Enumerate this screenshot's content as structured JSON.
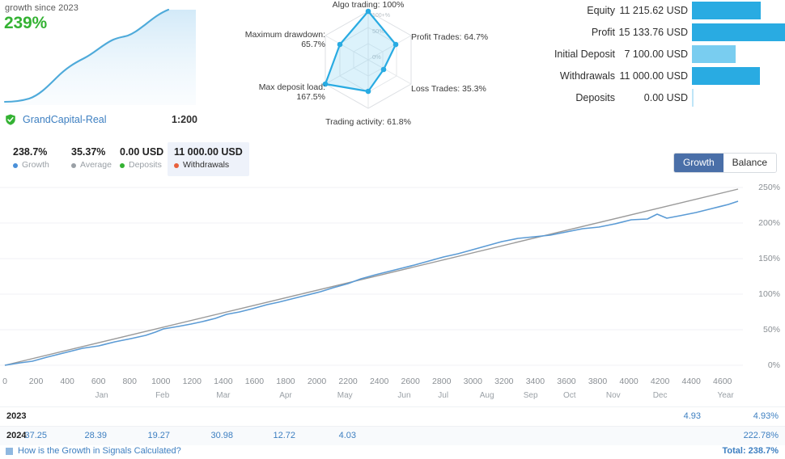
{
  "summary": {
    "growth_since_label": "growth since 2023",
    "growth_since_value": "239%",
    "broker": "GrandCapital-Real",
    "leverage": "1:200",
    "verified_icon": "shield-check-icon"
  },
  "radar": {
    "title": "",
    "ring_labels": [
      "100+%",
      "50%",
      "0%"
    ],
    "axes": [
      {
        "label": "Algo trading: 100%",
        "name": "Algo trading",
        "value": 100.0,
        "norm": 1.0
      },
      {
        "label": "Profit Trades: 64.7%",
        "name": "Profit Trades",
        "value": 64.7,
        "norm": 0.647
      },
      {
        "label": "Loss Trades: 35.3%",
        "name": "Loss Trades",
        "value": 35.3,
        "norm": 0.353
      },
      {
        "label": "Trading activity: 61.8%",
        "name": "Trading activity",
        "value": 61.8,
        "norm": 0.618
      },
      {
        "label": "Max deposit load: 167.5%",
        "name": "Max deposit load",
        "value": 167.5,
        "norm": 1.0
      },
      {
        "label": "Maximum drawdown: 65.7%",
        "name": "Maximum drawdown",
        "value": 65.7,
        "norm": 0.657
      }
    ]
  },
  "account_bars": {
    "rows": [
      {
        "name": "Equity",
        "value": "11 215.62 USD",
        "amount": 11215.62,
        "bar_pct": 74,
        "tone": "normal"
      },
      {
        "name": "Profit",
        "value": "15 133.76 USD",
        "amount": 15133.76,
        "bar_pct": 100,
        "tone": "normal"
      },
      {
        "name": "Initial Deposit",
        "value": "7 100.00 USD",
        "amount": 7100.0,
        "bar_pct": 47,
        "tone": "light"
      },
      {
        "name": "Withdrawals",
        "value": "11 000.00 USD",
        "amount": 11000.0,
        "bar_pct": 73,
        "tone": "normal"
      },
      {
        "name": "Deposits",
        "value": "0.00 USD",
        "amount": 0.0,
        "bar_pct": 0,
        "tone": "zero"
      }
    ]
  },
  "stats": [
    {
      "value": "238.7%",
      "key": "Growth",
      "color": "#4a90d9",
      "highlighted": false
    },
    {
      "value": "35.37%",
      "key": "Average",
      "color": "#9aa0a6",
      "highlighted": false
    },
    {
      "value": "0.00 USD",
      "key": "Deposits",
      "color": "#34b233",
      "highlighted": false
    },
    {
      "value": "11 000.00 USD",
      "key": "Withdrawals",
      "color": "#e8603c",
      "highlighted": true
    }
  ],
  "toggle": {
    "options": [
      "Growth",
      "Balance"
    ],
    "selected": "Growth"
  },
  "chart_data": {
    "type": "line",
    "title": "",
    "xlabel": "",
    "ylabel": "",
    "xlim": [
      0,
      4700
    ],
    "ylim": [
      0,
      250
    ],
    "yticks": [
      0,
      50,
      100,
      150,
      200,
      250
    ],
    "ytick_labels": [
      "0%",
      "50%",
      "100%",
      "150%",
      "200%",
      "250%"
    ],
    "xticks": [
      0,
      200,
      400,
      600,
      800,
      1000,
      1200,
      1400,
      1600,
      1800,
      2000,
      2200,
      2400,
      2600,
      2800,
      3000,
      3200,
      3400,
      3600,
      3800,
      4000,
      4200,
      4400,
      4600
    ],
    "month_ticks": [
      {
        "label": "Jan",
        "x": 620
      },
      {
        "label": "Feb",
        "x": 1010
      },
      {
        "label": "Mar",
        "x": 1400
      },
      {
        "label": "Apr",
        "x": 1800
      },
      {
        "label": "May",
        "x": 2180
      },
      {
        "label": "Jun",
        "x": 2560
      },
      {
        "label": "Jul",
        "x": 2810
      },
      {
        "label": "Aug",
        "x": 3090
      },
      {
        "label": "Sep",
        "x": 3370
      },
      {
        "label": "Oct",
        "x": 3620
      },
      {
        "label": "Nov",
        "x": 3900
      },
      {
        "label": "Dec",
        "x": 4200
      },
      {
        "label": "Year",
        "x": 4620
      }
    ],
    "grid": true,
    "legend_position": "top-left",
    "series": [
      {
        "name": "Growth",
        "color": "#4a90d9",
        "x": [
          0,
          120,
          200,
          300,
          420,
          520,
          620,
          720,
          820,
          900,
          960,
          1010,
          1100,
          1180,
          1250,
          1330,
          1400,
          1480,
          1560,
          1650,
          1720,
          1800,
          1900,
          1980,
          2060,
          2150,
          2230,
          2320,
          2400,
          2480,
          2560,
          2650,
          2740,
          2830,
          2920,
          3010,
          3100,
          3200,
          3300,
          3400,
          3500,
          3600,
          3700,
          3800,
          3900,
          4000,
          4060,
          4120,
          4200,
          4300,
          4400,
          4500,
          4620
        ],
        "y": [
          0,
          4,
          7,
          12,
          18,
          23,
          27,
          32,
          37,
          41,
          46,
          51,
          55,
          58,
          62,
          66,
          72,
          76,
          80,
          86,
          90,
          95,
          101,
          106,
          112,
          118,
          125,
          131,
          136,
          141,
          146,
          152,
          157,
          162,
          168,
          173,
          179,
          184,
          186,
          189,
          193,
          198,
          200,
          205,
          210,
          212,
          219,
          214,
          217,
          222,
          228,
          233,
          238
        ]
      },
      {
        "name": "Average",
        "color": "#9a9a9a",
        "x": [
          0,
          4620
        ],
        "y": [
          0,
          248
        ]
      }
    ]
  },
  "table": {
    "months": [
      "Jan",
      "Feb",
      "Mar",
      "Apr",
      "May",
      "Jun",
      "Jul",
      "Aug",
      "Sep",
      "Oct",
      "Nov",
      "Dec"
    ],
    "rows": [
      {
        "year": "2023",
        "values": [
          "",
          "",
          "",
          "",
          "",
          "",
          "",
          "",
          "",
          "",
          "",
          "4.93"
        ],
        "yearly": "4.93%"
      },
      {
        "year": "2024",
        "values": [
          "37.25",
          "28.39",
          "19.27",
          "30.98",
          "12.72",
          "4.03",
          "",
          "",
          "",
          "",
          "",
          ""
        ],
        "yearly": "222.78%"
      }
    ]
  },
  "footer": {
    "link": "How is the Growth in Signals Calculated?",
    "link_icon": "info-icon",
    "total": "Total: 238.7%"
  }
}
